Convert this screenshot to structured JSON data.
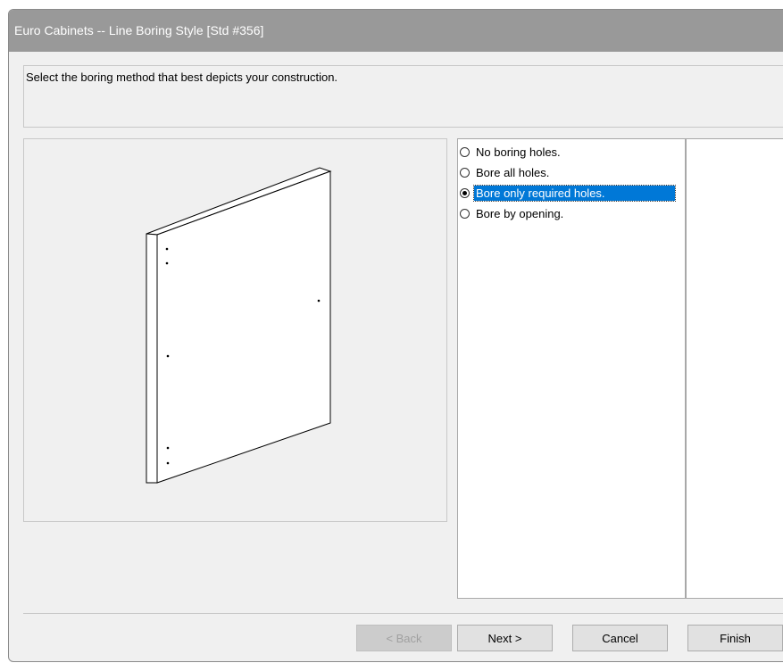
{
  "window": {
    "title": "Euro Cabinets -- Line Boring Style [Std #356]"
  },
  "instruction": {
    "text": "Select the boring method that best depicts your construction."
  },
  "options": [
    {
      "label": "No boring holes.",
      "checked": false
    },
    {
      "label": "Bore all holes.",
      "checked": false
    },
    {
      "label": "Bore only required holes.",
      "checked": true
    },
    {
      "label": "Bore by opening.",
      "checked": false
    }
  ],
  "buttons": {
    "back": "< Back",
    "next": "Next >",
    "cancel": "Cancel",
    "finish": "Finish"
  },
  "colors": {
    "selection": "#0078d7",
    "titlebar": "#999999"
  }
}
